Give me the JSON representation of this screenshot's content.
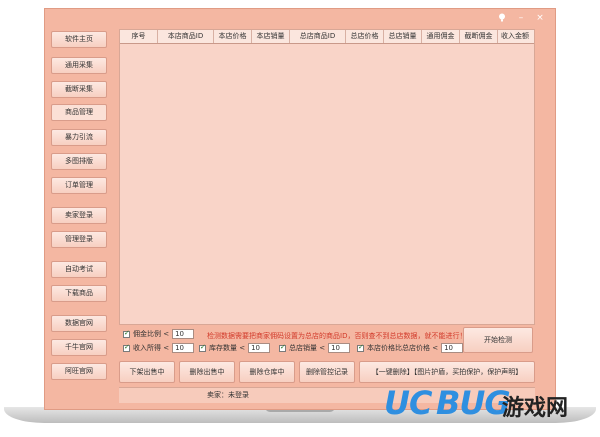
{
  "window": {
    "title_icons": [
      "lamp-icon",
      "minimize-icon",
      "close-icon"
    ],
    "minimize_glyph": "–",
    "close_glyph": "×"
  },
  "sidebar": {
    "items": [
      {
        "label": "软件主页"
      },
      {
        "label": "通用采集"
      },
      {
        "label": "截断采集"
      },
      {
        "label": "商品管理"
      },
      {
        "label": "暴力引流"
      },
      {
        "label": "多图排版"
      },
      {
        "label": "订单管理"
      },
      {
        "label": "卖家登录"
      },
      {
        "label": "管理登录"
      },
      {
        "label": "自动考试"
      },
      {
        "label": "下载商品"
      },
      {
        "label": "数据官网"
      },
      {
        "label": "千牛官网"
      },
      {
        "label": "阿旺官网"
      }
    ]
  },
  "table": {
    "columns": [
      "序号",
      "本店商品ID",
      "本店价格",
      "本店销量",
      "总店商品ID",
      "总店价格",
      "总店销量",
      "通用佣金",
      "截断佣金",
      "收入金额"
    ]
  },
  "filters": {
    "commission_label": "佣金比例 <",
    "commission_value": "10",
    "warning": "检测数据需要把商家佣码设置为总店的商品ID，否则查不到总店数据，就不能进行！",
    "income_label": "收入所得 <",
    "income_value": "10",
    "stock_label": "库存数量 <",
    "stock_value": "10",
    "sales_label": "总店销量 <",
    "sales_value": "10",
    "price_label": "本店价格比总店价格 <",
    "price_value": "10",
    "start_button": "开始检测"
  },
  "actions": {
    "btn1": "下架出售中",
    "btn2": "删除出售中",
    "btn3": "删除仓库中",
    "btn4": "删除管控记录",
    "btn5": "【一键删除】【图片护盾，买拍保护，保护声明】"
  },
  "status": {
    "seller": "卖家：未登录"
  },
  "watermark": {
    "uc": "UC",
    "bug": "BUG",
    "cn": "游戏网"
  },
  "colors": {
    "bezel": "#f4b7a2",
    "table_bg": "#f9d4c8",
    "warning": "#d23a2a",
    "watermark_blue": "#2f8fe0"
  }
}
